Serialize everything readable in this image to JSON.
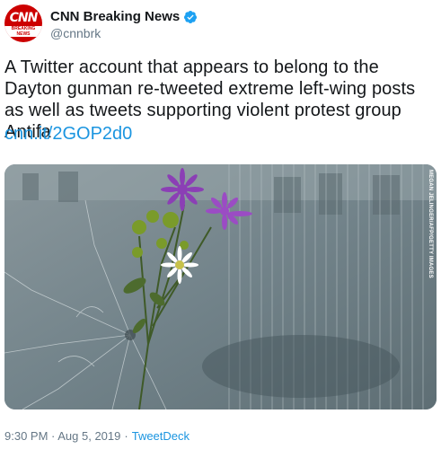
{
  "account": {
    "display_name": "CNN Breaking News",
    "handle": "@cnnbrk",
    "avatar": {
      "logo_text": "CNN",
      "sub_text": "BREAKING NEWS",
      "bg_color": "#cc0000"
    },
    "verified_icon": "verified-badge-icon"
  },
  "tweet": {
    "text": "A Twitter account that appears to belong to the Dayton gunman re-tweeted extreme left-wing posts as well as tweets supporting violent protest group Antifa",
    "link": "cnn.it/2GOP2d0",
    "photo_credit": "MEGAN JELINGER/AFP/GETTY IMAGES",
    "timestamp": "9:30 PM · Aug 5, 2019",
    "separator": "·",
    "source": "TweetDeck"
  },
  "colors": {
    "link": "#1b95e0",
    "muted": "#657786",
    "text": "#14171a"
  }
}
